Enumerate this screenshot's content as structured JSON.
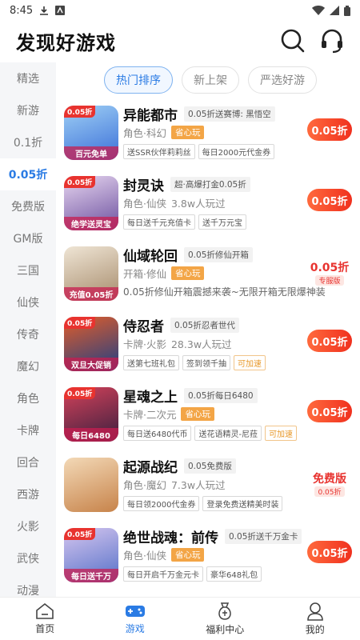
{
  "status": {
    "time": "8:45"
  },
  "header": {
    "title": "发现好游戏"
  },
  "sidebar": {
    "items": [
      "精选",
      "新游",
      "0.1折",
      "0.05折",
      "免费版",
      "GM版",
      "三国",
      "仙侠",
      "传奇",
      "魔幻",
      "角色",
      "卡牌",
      "回合",
      "西游",
      "火影",
      "武侠",
      "动漫"
    ],
    "active_index": 3
  },
  "tabs": [
    {
      "label": "热门排序",
      "active": true
    },
    {
      "label": "新上架",
      "active": false
    },
    {
      "label": "严选好游",
      "active": false
    }
  ],
  "games": [
    {
      "title": "异能都市",
      "promo": "0.05折送赛博: 黑悟空",
      "genre": "角色·科幻",
      "players": "",
      "save_badge": "省心玩",
      "tags": [
        "送SSR伙伴莉莉丝",
        "每日2000元代金券"
      ],
      "price": "0.05折",
      "corner": "0.05折",
      "banner": "百元免单"
    },
    {
      "title": "封灵诀",
      "promo": "超·高爆打金0.05折",
      "genre": "角色·仙侠",
      "players": "3.8w人玩过",
      "save_badge": "",
      "tags": [
        "每日送千元充值卡",
        "送千万元宝"
      ],
      "price": "0.05折",
      "corner": "0.05折",
      "banner": "绝学送灵宝"
    },
    {
      "title": "仙域轮回",
      "promo": "0.05折修仙开箱",
      "genre": "开箱·修仙",
      "players": "",
      "save_badge": "省心玩",
      "desc": "0.05折修仙开箱震撼来袭~无限开箱无限爆神装",
      "seal": {
        "big": "0.05折",
        "small": "专服版"
      },
      "corner": "",
      "banner": "充值0.05折"
    },
    {
      "title": "侍忍者",
      "promo": "0.05折忍者世代",
      "genre": "卡牌·火影",
      "players": "28.3w人玩过",
      "save_badge": "",
      "tags": [
        "送第七班礼包",
        "签到领千抽"
      ],
      "tag_orange": "可加速",
      "price": "0.05折",
      "corner": "0.05折",
      "banner": "双旦大促销"
    },
    {
      "title": "星魂之上",
      "promo": "0.05折每日6480",
      "genre": "卡牌·二次元",
      "players": "",
      "save_badge": "省心玩",
      "tags": [
        "每日送6480代币",
        "送花语精灵-尼菈"
      ],
      "tag_orange": "可加速",
      "price": "0.05折",
      "corner": "0.05折",
      "banner": "每日6480"
    },
    {
      "title": "起源战纪",
      "promo": "0.05免费版",
      "genre": "角色·魔幻",
      "players": "7.3w人玩过",
      "save_badge": "",
      "tags": [
        "每日领2000代金券",
        "登录免费送精美时装"
      ],
      "seal": {
        "big": "免费版",
        "small": "0.05折"
      },
      "corner": "",
      "banner": ""
    },
    {
      "title": "绝世战魂：前传",
      "promo": "0.05折送千万金卡",
      "genre": "角色·仙侠",
      "players": "",
      "save_badge": "省心玩",
      "tags": [
        "每日开启千万金元卡",
        "豪华648礼包"
      ],
      "price": "0.05折",
      "corner": "0.05折",
      "banner": "每日送千万"
    }
  ],
  "bottom_nav": [
    {
      "label": "首页",
      "icon": "home-icon",
      "active": false
    },
    {
      "label": "游戏",
      "icon": "gamepad-icon",
      "active": true
    },
    {
      "label": "福利中心",
      "icon": "gift-bag-icon",
      "active": false
    },
    {
      "label": "我的",
      "icon": "user-icon",
      "active": false
    }
  ]
}
